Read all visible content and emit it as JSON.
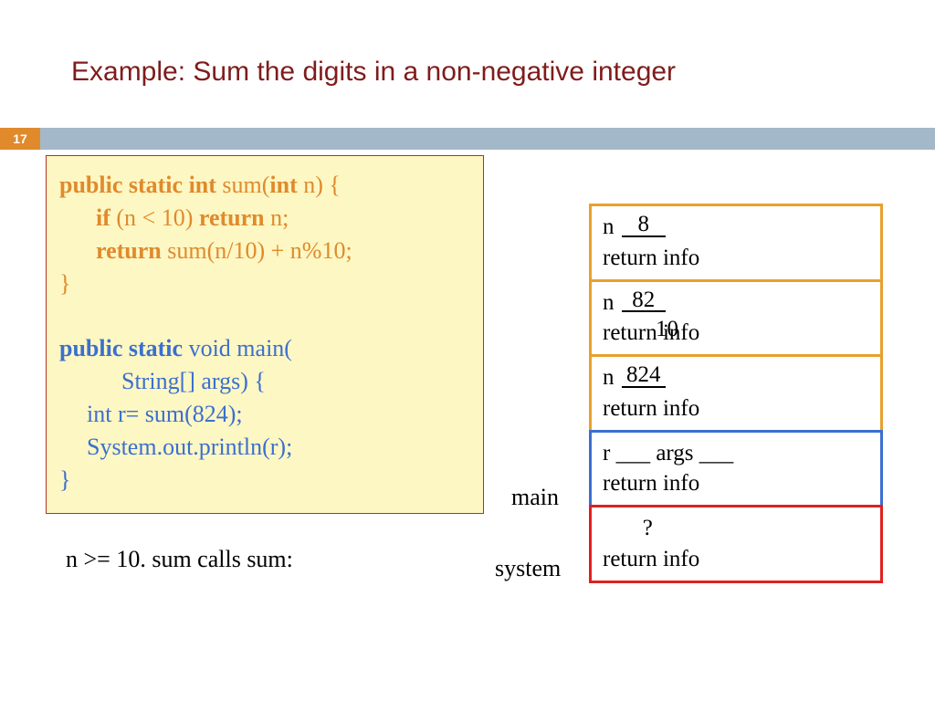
{
  "page_number": "17",
  "title": "Example: Sum the digits in a non-negative integer",
  "code": {
    "kw_sig": "public static int",
    "fn_sum": "sum(",
    "kw_int": "int",
    "param": " n) {",
    "kw_if": "if",
    "cond": " (n < 10) ",
    "kw_return": "return",
    "ret_n": " n;",
    "ret2_prefix": " sum(n/10)  +  n%10;",
    "close_brace": "}",
    "kw_main_sig": "public static",
    "main_void": " void main(",
    "main_args": "String[] args) {",
    "main_l1": "int r= sum(824);",
    "main_l2": "System.out.println(r);"
  },
  "note": "n >= 10. sum calls sum:",
  "labels": {
    "main": "main",
    "system": "system"
  },
  "frames": [
    {
      "line1_prefix": "n ",
      "value": "8",
      "line2": "return info"
    },
    {
      "line1_prefix": "n ",
      "value": "82",
      "line2": "return info",
      "overlap": "10"
    },
    {
      "line1_prefix": "n ",
      "value": "824",
      "line2": "return info"
    },
    {
      "line1": "r ___  args ___",
      "line2": "return info"
    },
    {
      "line1": "       ?",
      "line2": "return info"
    }
  ]
}
